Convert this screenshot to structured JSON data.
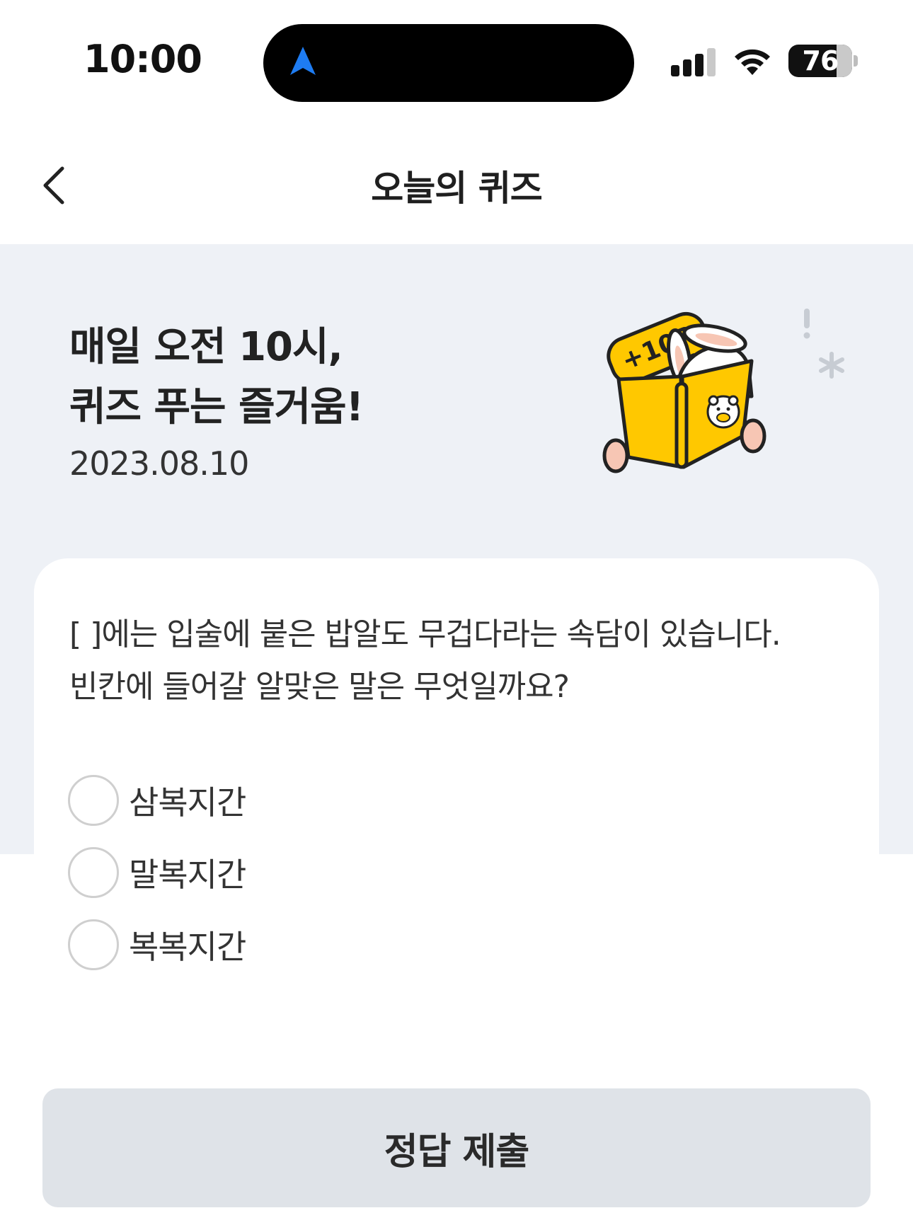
{
  "status_bar": {
    "time": "10:00",
    "battery_level": "76",
    "icons": [
      "navigation-arrow-icon",
      "cellular-signal-icon",
      "wifi-icon",
      "battery-icon"
    ]
  },
  "header": {
    "title": "오늘의 퀴즈",
    "back_icon": "chevron-left-icon"
  },
  "hero": {
    "title_line1": "매일 오전 10시,",
    "title_line2": "퀴즈 푸는 즐거움!",
    "date": "2023.08.10",
    "badge_text": "+10P"
  },
  "quiz": {
    "question_line1": "[ ]에는 입술에 붙은 밥알도 무겁다라는 속담이 있습니다.",
    "question_line2": "빈칸에 들어갈 알맞은 말은 무엇일까요?",
    "options": [
      {
        "label": "삼복지간",
        "selected": false
      },
      {
        "label": "말복지간",
        "selected": false
      },
      {
        "label": "복복지간",
        "selected": false
      }
    ]
  },
  "submit": {
    "label": "정답 제출"
  },
  "colors": {
    "hero_background": "#eef1f6",
    "button_background": "#dfe3e8",
    "accent_yellow": "#ffc800",
    "navigation_blue": "#1e7cf2"
  }
}
